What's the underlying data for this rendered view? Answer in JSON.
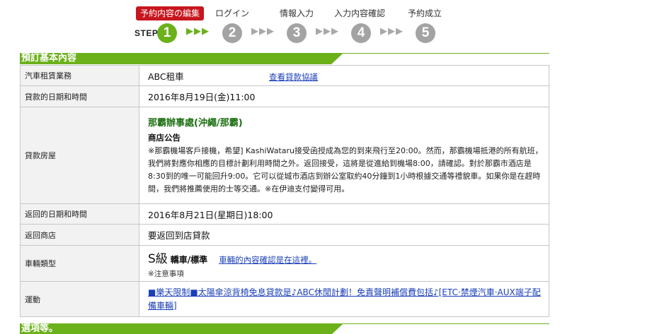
{
  "steps": {
    "labels": [
      "予約内容の編集",
      "ログイン",
      "情報入力",
      "入力内容確認",
      "予約成立"
    ],
    "step_word": "STEP",
    "numbers": [
      "1",
      "2",
      "3",
      "4",
      "5"
    ],
    "arrows": "▶▶▶",
    "active_index": 0
  },
  "colors": {
    "accent_green": "#6bb11a",
    "active_tab_red": "#c7161d",
    "link_blue": "#1a3fb8"
  },
  "section1": {
    "title": "預訂基本內容"
  },
  "rows": {
    "company": {
      "label": "汽車租賃業務",
      "value": "ABC租車",
      "link": "查看貸款協議"
    },
    "pickup_datetime": {
      "label": "貸款的日期和時間",
      "value": "2016年8月19日(金)11:00"
    },
    "pickup_store": {
      "label": "貸款房屋",
      "store_name": "那霸辦事處(沖繩/那霸)",
      "notice_title": "商店公告",
      "notice_body": "※那霸機場客戶接機，希望] KashiWataru接受函授成為您的到來飛行至20:00。然而，那霸機場抵港的所有航班，我們將對應你相應的目標計劃利用時間之外。返回接受，這將是從進給到機場8:00，請確認。對於那霸市酒店是8:30到的唯一可能回升9:00。它可以從城市酒店到辦公室取約40分鐘到1小時根據交通等禮貌車。如果你是在趕時間，我們將推薦使用的士等交通。※在伊迪支付變得可用。"
    },
    "return_datetime": {
      "label": "返回的日期和時間",
      "value": "2016年8月21日(星期日)18:00"
    },
    "return_store": {
      "label": "返回商店",
      "value": "要返回到店貸款"
    },
    "car_class": {
      "label": "車輛類型",
      "class_big": "S級",
      "class_sub": "轎車/標準",
      "link": "車輛的內容確認是在這裡。",
      "note": "※注意事項"
    },
    "campaign": {
      "label": "運動",
      "link": "■樂天限制■太陽傘涼背椅免息貸款是♪ABC休閒計劃！免責聲明補償費包括♪[ETC·禁煙汽車·AUX端子配備車輛]"
    }
  },
  "section2": {
    "title": "選項等。"
  }
}
